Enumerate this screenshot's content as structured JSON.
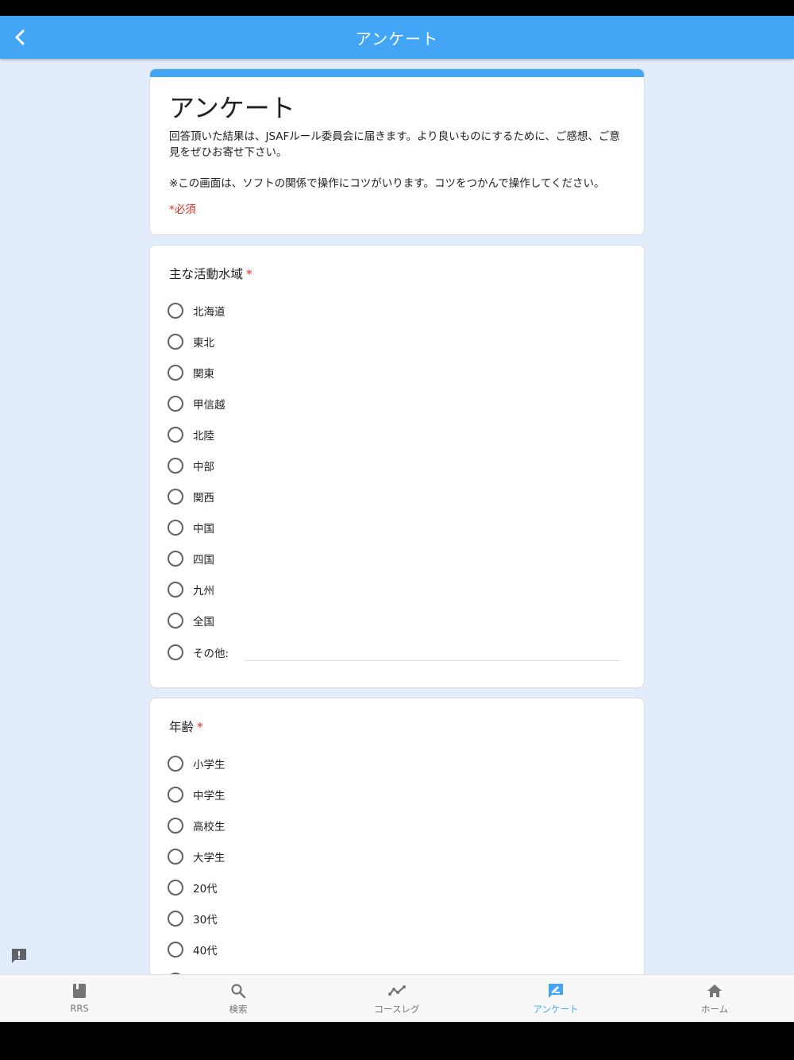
{
  "app_bar": {
    "title": "アンケート",
    "back_icon": "chevron-left-icon"
  },
  "form": {
    "title": "アンケート",
    "description": "回答頂いた結果は、JSAFルール委員会に届きます。より良いものにするために、ご感想、ご意見をぜひお寄せ下さい。",
    "note": "※この画面は、ソフトの関係で操作にコツがいります。コツをつかんで操作してください。",
    "required_label": "*必須"
  },
  "questions": [
    {
      "title": "主な活動水域",
      "required_mark": "*",
      "options": [
        "北海道",
        "東北",
        "関東",
        "甲信越",
        "北陸",
        "中部",
        "関西",
        "中国",
        "四国",
        "九州",
        "全国",
        "その他:"
      ]
    },
    {
      "title": "年齢",
      "required_mark": "*",
      "options": [
        "小学生",
        "中学生",
        "高校生",
        "大学生",
        "20代",
        "30代",
        "40代"
      ]
    }
  ],
  "bottom_nav": {
    "items": [
      {
        "label": "RRS",
        "icon": "book-icon"
      },
      {
        "label": "検索",
        "icon": "search-icon"
      },
      {
        "label": "コースレグ",
        "icon": "line-chart-icon"
      },
      {
        "label": "アンケート",
        "icon": "feedback-edit-icon",
        "active": true
      },
      {
        "label": "ホーム",
        "icon": "home-icon"
      }
    ]
  },
  "colors": {
    "primary": "#42a5f5",
    "required": "#d93025",
    "background": "#e3ecfb"
  }
}
